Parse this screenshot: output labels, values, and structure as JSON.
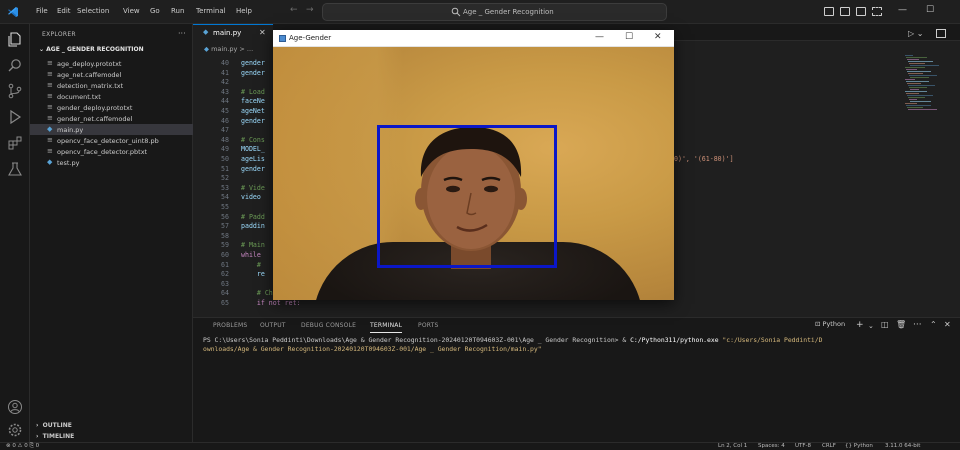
{
  "titlebar": {
    "menu": [
      "File",
      "Edit",
      "Selection",
      "View",
      "Go",
      "Run",
      "Terminal",
      "Help"
    ],
    "command_center": "Age _ Gender Recognition"
  },
  "sidebar": {
    "title": "EXPLORER",
    "folder": "AGE _ GENDER RECOGNITION",
    "files": [
      {
        "name": "age_deploy.prototxt",
        "icon": "text-file-icon"
      },
      {
        "name": "age_net.caffemodel",
        "icon": "text-file-icon"
      },
      {
        "name": "detection_matrix.txt",
        "icon": "text-file-icon"
      },
      {
        "name": "document.txt",
        "icon": "text-file-icon"
      },
      {
        "name": "gender_deploy.prototxt",
        "icon": "text-file-icon"
      },
      {
        "name": "gender_net.caffemodel",
        "icon": "text-file-icon"
      },
      {
        "name": "main.py",
        "icon": "python-file-icon",
        "selected": true
      },
      {
        "name": "opencv_face_detector_uint8.pb",
        "icon": "text-file-icon"
      },
      {
        "name": "opencv_face_detector.pbtxt",
        "icon": "text-file-icon"
      },
      {
        "name": "test.py",
        "icon": "python-file-icon"
      }
    ],
    "outline": "OUTLINE",
    "timeline": "TIMELINE"
  },
  "editor": {
    "tab": "main.py",
    "breadcrumb": "main.py > ...",
    "lines": [
      {
        "n": "40",
        "text": "gender",
        "kind": "code"
      },
      {
        "n": "41",
        "text": "gender",
        "kind": "code"
      },
      {
        "n": "42",
        "text": "",
        "kind": "code"
      },
      {
        "n": "43",
        "text": "# Load",
        "kind": "comment"
      },
      {
        "n": "44",
        "text": "faceNe",
        "kind": "code"
      },
      {
        "n": "45",
        "text": "ageNet",
        "kind": "code"
      },
      {
        "n": "46",
        "text": "gender",
        "kind": "code"
      },
      {
        "n": "47",
        "text": "",
        "kind": "code"
      },
      {
        "n": "48",
        "text": "# Cons",
        "kind": "comment"
      },
      {
        "n": "49",
        "text": "MODEL_",
        "kind": "code"
      },
      {
        "n": "50",
        "text": "ageLis",
        "kind": "code"
      },
      {
        "n": "51",
        "text": "gender",
        "kind": "code"
      },
      {
        "n": "52",
        "text": "",
        "kind": "code"
      },
      {
        "n": "53",
        "text": "# Vide",
        "kind": "comment"
      },
      {
        "n": "54",
        "text": "video ",
        "kind": "code"
      },
      {
        "n": "55",
        "text": "",
        "kind": "code"
      },
      {
        "n": "56",
        "text": "# Padd",
        "kind": "comment"
      },
      {
        "n": "57",
        "text": "paddin",
        "kind": "code"
      },
      {
        "n": "58",
        "text": "",
        "kind": "code"
      },
      {
        "n": "59",
        "text": "# Main",
        "kind": "comment"
      },
      {
        "n": "60",
        "text": "while ",
        "kind": "keyword"
      },
      {
        "n": "61",
        "text": "    #",
        "kind": "comment"
      },
      {
        "n": "62",
        "text": "    re",
        "kind": "code"
      },
      {
        "n": "63",
        "text": "",
        "kind": "code"
      },
      {
        "n": "64",
        "text": "    # Check if the frame is successfully read",
        "kind": "comment"
      },
      {
        "n": "65",
        "text": "    if not ret:",
        "kind": "keyword"
      }
    ],
    "line50_tail": "0)', '(61-80)']"
  },
  "app_window": {
    "title": "Age-Gender",
    "minimize": "—",
    "maximize": "☐",
    "close": "✕",
    "face_box_color": "#0b17c8"
  },
  "panel": {
    "tabs": [
      "PROBLEMS",
      "OUTPUT",
      "DEBUG CONSOLE",
      "TERMINAL",
      "PORTS"
    ],
    "active_tab": "TERMINAL",
    "terminal_profile": "Python",
    "prompt": "PS C:\\Users\\Sonia Peddinti\\Downloads\\Age & Gender Recognition-20240120T094603Z-001\\Age _ Gender Recognition> & ",
    "python_exe": "C:/Python311/python.exe",
    "script_path_1": " \"c:/Users/Sonia Peddinti/D",
    "script_path_2": "ownloads/Age & Gender Recognition-20240120T094603Z-001/Age _ Gender Recognition/main.py\""
  },
  "statusbar": {
    "left": "⊗ 0 ⚠ 0   ⎘ 0",
    "position": "Ln 2, Col 1",
    "spaces": "Spaces: 4",
    "encoding": "UTF-8",
    "eol": "CRLF",
    "language": "{} Python",
    "interpreter": "3.11.0 64-bit"
  }
}
